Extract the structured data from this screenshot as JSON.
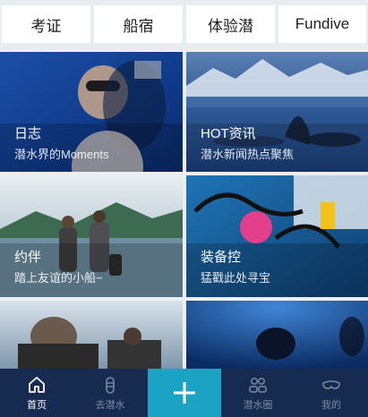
{
  "top_tabs": [
    "考证",
    "船宿",
    "体验潜",
    "Fundive"
  ],
  "cards": [
    {
      "title": "日志",
      "subtitle": "潜水界的Moments"
    },
    {
      "title": "HOT资讯",
      "subtitle": "潜水新闻热点聚焦"
    },
    {
      "title": "约伴",
      "subtitle": "踏上友谊的小船~"
    },
    {
      "title": "装备控",
      "subtitle": "猛戳此处寻宝"
    }
  ],
  "tabbar": {
    "items": [
      {
        "label": "首页",
        "icon": "home-icon",
        "active": true
      },
      {
        "label": "去潜水",
        "icon": "dive-tank-icon",
        "active": false
      },
      {
        "label": "潜水圈",
        "icon": "people-icon",
        "active": false
      },
      {
        "label": "我的",
        "icon": "mask-icon",
        "active": false
      }
    ],
    "center_icon": "plus-icon"
  },
  "colors": {
    "tabbar_bg": "#162b4f",
    "accent": "#1aa3c2",
    "active_label": "#ffffff",
    "inactive_label": "#7e8aa0"
  }
}
